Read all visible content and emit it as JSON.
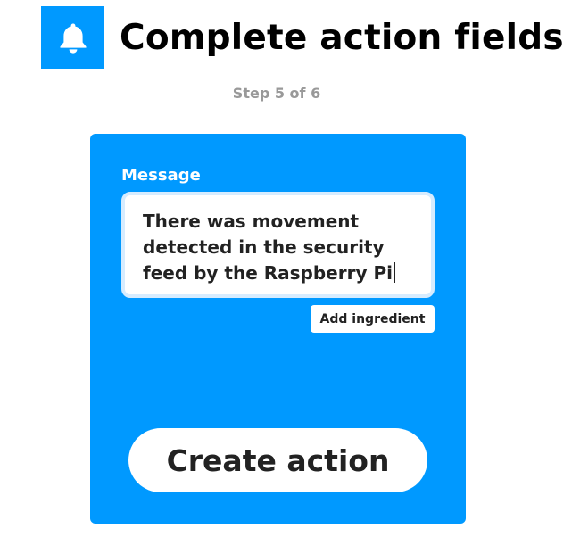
{
  "header": {
    "service_icon": "bell-icon",
    "title": "Complete action fields",
    "step": "Step 5 of 6"
  },
  "card": {
    "field_label": "Message",
    "field_value": "There was movement\ndetected in the security\nfeed by the Raspberry Pi",
    "add_ingredient_label": "Add ingredient",
    "create_action_label": "Create action"
  },
  "colors": {
    "accent": "#0099ff",
    "text": "#222222",
    "muted": "#999999"
  }
}
